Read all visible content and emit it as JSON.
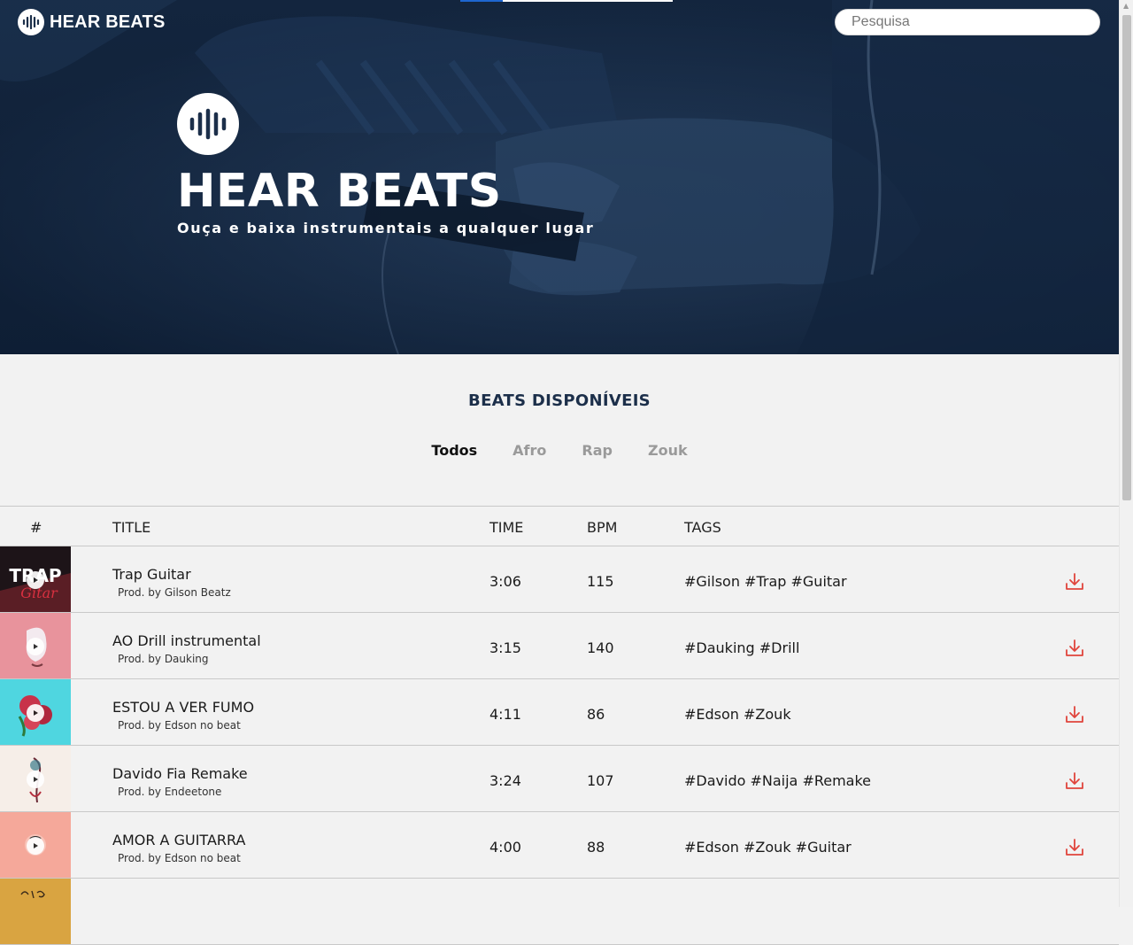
{
  "navbar": {
    "brand": "HEAR BEATS",
    "search_placeholder": "Pesquisa"
  },
  "hero": {
    "title": "HEAR BEATS",
    "subtitle": "Ouça e baixa instrumentais a qualquer lugar"
  },
  "section": {
    "title": "BEATS DISPONÍVEIS",
    "filters": [
      "Todos",
      "Afro",
      "Rap",
      "Zouk"
    ],
    "active_filter": "Todos"
  },
  "table": {
    "headers": {
      "index": "#",
      "title": "TITLE",
      "time": "TIME",
      "bpm": "BPM",
      "tags": "TAGS"
    },
    "rows": [
      {
        "title": "Trap Guitar",
        "producer": "Prod. by Gilson Beatz",
        "time": "3:06",
        "bpm": "115",
        "tags": "#Gilson #Trap #Guitar"
      },
      {
        "title": "AO Drill instrumental",
        "producer": "Prod. by Dauking",
        "time": "3:15",
        "bpm": "140",
        "tags": "#Dauking #Drill"
      },
      {
        "title": "ESTOU A VER FUMO",
        "producer": "Prod. by Edson no beat",
        "time": "4:11",
        "bpm": "86",
        "tags": "#Edson #Zouk"
      },
      {
        "title": "Davido Fia Remake",
        "producer": "Prod. by Endeetone",
        "time": "3:24",
        "bpm": "107",
        "tags": "#Davido #Naija #Remake"
      },
      {
        "title": "AMOR A GUITARRA",
        "producer": "Prod. by Edson no beat",
        "time": "4:00",
        "bpm": "88",
        "tags": "#Edson #Zouk #Guitar"
      }
    ]
  },
  "colors": {
    "hero_overlay": "#0f2038",
    "heading": "#1c2f4a",
    "download_icon": "#e0443c",
    "filter_inactive": "#9a9a9a"
  }
}
